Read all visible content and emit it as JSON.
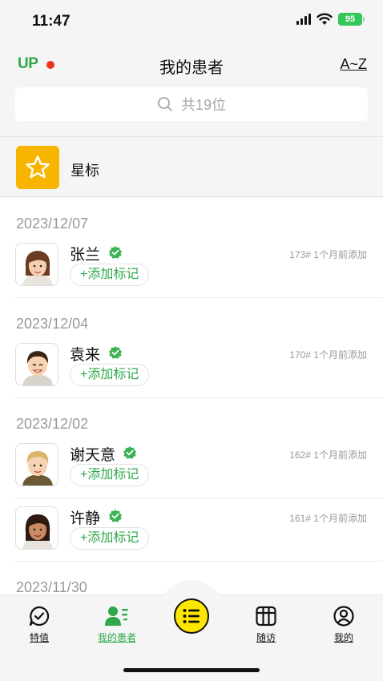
{
  "status_bar": {
    "time": "11:47",
    "battery": "95"
  },
  "header": {
    "logo": "UP",
    "title": "我的患者",
    "sort_label": "A~Z",
    "search_placeholder": "共19位"
  },
  "star_section": {
    "label": "星标"
  },
  "groups": [
    {
      "date": "2023/12/07",
      "patients": [
        {
          "name": "张兰",
          "meta": "173# 1个月前添加",
          "tag_label": "+添加标记"
        }
      ]
    },
    {
      "date": "2023/12/04",
      "patients": [
        {
          "name": "袁来",
          "meta": "170# 1个月前添加",
          "tag_label": "+添加标记"
        }
      ]
    },
    {
      "date": "2023/12/02",
      "patients": [
        {
          "name": "谢天意",
          "meta": "162# 1个月前添加",
          "tag_label": "+添加标记"
        },
        {
          "name": "许静",
          "meta": "161# 1个月前添加",
          "tag_label": "+添加标记"
        }
      ]
    },
    {
      "date": "2023/11/30",
      "patients": []
    }
  ],
  "tab_bar": {
    "tabs": [
      {
        "label": "特值",
        "icon": "chat-check-icon"
      },
      {
        "label": "我的患者",
        "icon": "patients-icon",
        "active": true
      },
      {
        "label": "随访",
        "icon": "calendar-grid-icon"
      },
      {
        "label": "我的",
        "icon": "profile-icon"
      }
    ],
    "center_icon": "list-menu-icon"
  },
  "colors": {
    "accent_green": "#2fa84a",
    "star_yellow": "#f7b500",
    "center_yellow": "#ffe600",
    "logo_dot": "#e32222"
  }
}
